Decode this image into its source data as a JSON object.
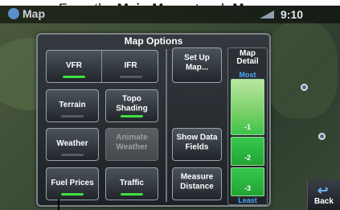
{
  "caption": {
    "prefix": "From the ",
    "bold1": "Main Menu",
    "middle": ", touch ",
    "bold2": "Ma"
  },
  "statusbar": {
    "title": "Map",
    "time": "9:10"
  },
  "dialog": {
    "title": "Map Options",
    "segment": {
      "left_label": "VFR",
      "left_on": true,
      "right_label": "IFR",
      "right_on": false
    },
    "buttons": {
      "terrain": "Terrain",
      "topo": "Topo Shading",
      "weather": "Weather",
      "animate": "Animate Weather",
      "fuel": "Fuel Prices",
      "traffic": "Traffic",
      "setup": "Set Up Map...",
      "show_fields": "Show Data Fields",
      "measure": "Measure Distance"
    },
    "detail": {
      "title": "Map Detail",
      "most": "Most",
      "least": "Least",
      "levels": [
        "-1",
        "-2",
        "-3"
      ],
      "selected_level": "-1"
    }
  },
  "back": {
    "label": "Back"
  },
  "colors": {
    "accent_green": "#3fe040",
    "accent_blue": "#4aa6ff",
    "dialog_bg": "#1e2226"
  }
}
